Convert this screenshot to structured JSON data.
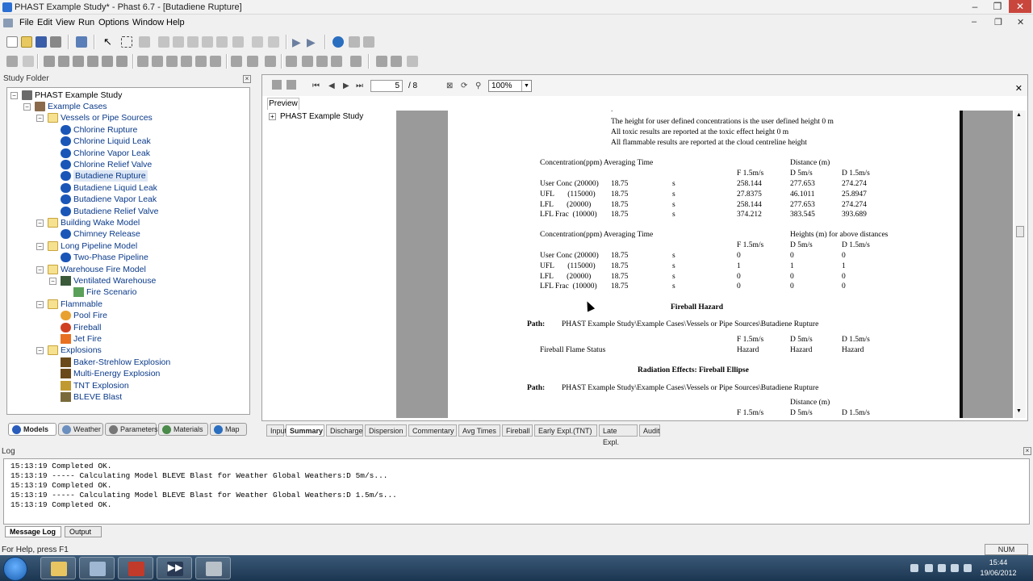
{
  "window": {
    "title": "PHAST Example Study* - Phast 6.7 - [Butadiene Rupture]"
  },
  "menu": [
    "File",
    "Edit",
    "View",
    "Run",
    "Options",
    "Window",
    "Help"
  ],
  "study_folder": {
    "title": "Study Folder",
    "root": "PHAST Example Study",
    "nodes": [
      {
        "label": "Example Cases",
        "depth": 1,
        "icon": "cases-icon",
        "expand": "-"
      },
      {
        "label": "Vessels or Pipe Sources",
        "depth": 2,
        "icon": "folder-icon",
        "expand": "-"
      },
      {
        "label": "Chlorine Rupture",
        "depth": 3,
        "icon": "model-icon",
        "expand": ""
      },
      {
        "label": "Chlorine Liquid Leak",
        "depth": 3,
        "icon": "model-icon",
        "expand": ""
      },
      {
        "label": "Chlorine Vapor Leak",
        "depth": 3,
        "icon": "model-icon",
        "expand": ""
      },
      {
        "label": "Chlorine Relief Valve",
        "depth": 3,
        "icon": "model-icon",
        "expand": ""
      },
      {
        "label": "Butadiene Rupture",
        "depth": 3,
        "icon": "model-icon",
        "expand": "",
        "selected": true
      },
      {
        "label": "Butadiene Liquid Leak",
        "depth": 3,
        "icon": "model-icon",
        "expand": ""
      },
      {
        "label": "Butadiene Vapor Leak",
        "depth": 3,
        "icon": "model-icon",
        "expand": ""
      },
      {
        "label": "Butadiene Relief Valve",
        "depth": 3,
        "icon": "model-icon",
        "expand": ""
      },
      {
        "label": "Building Wake Model",
        "depth": 2,
        "icon": "folder-icon",
        "expand": "-"
      },
      {
        "label": "Chimney Release",
        "depth": 3,
        "icon": "model-icon",
        "expand": ""
      },
      {
        "label": "Long Pipeline Model",
        "depth": 2,
        "icon": "folder-icon",
        "expand": "-"
      },
      {
        "label": "Two-Phase Pipeline",
        "depth": 3,
        "icon": "model-icon",
        "expand": ""
      },
      {
        "label": "Warehouse Fire Model",
        "depth": 2,
        "icon": "folder-icon",
        "expand": "-"
      },
      {
        "label": "Ventilated Warehouse",
        "depth": 3,
        "icon": "warehouse-icon",
        "expand": "-"
      },
      {
        "label": "Fire Scenario",
        "depth": 4,
        "icon": "fire-scenario-icon",
        "expand": ""
      },
      {
        "label": "Flammable",
        "depth": 2,
        "icon": "folder-icon",
        "expand": "-"
      },
      {
        "label": "Pool Fire",
        "depth": 3,
        "icon": "pool-fire-icon",
        "expand": ""
      },
      {
        "label": "Fireball",
        "depth": 3,
        "icon": "fireball-icon",
        "expand": ""
      },
      {
        "label": "Jet Fire",
        "depth": 3,
        "icon": "jet-fire-icon",
        "expand": ""
      },
      {
        "label": "Explosions",
        "depth": 2,
        "icon": "folder-icon",
        "expand": "-"
      },
      {
        "label": "Baker-Strehlow Explosion",
        "depth": 3,
        "icon": "explosion-icon",
        "expand": ""
      },
      {
        "label": "Multi-Energy Explosion",
        "depth": 3,
        "icon": "explosion-icon",
        "expand": ""
      },
      {
        "label": "TNT Explosion",
        "depth": 3,
        "icon": "tnt-icon",
        "expand": ""
      },
      {
        "label": "BLEVE Blast",
        "depth": 3,
        "icon": "bleve-icon",
        "expand": ""
      }
    ],
    "tabs": [
      "Models",
      "Weather",
      "Parameters",
      "Materials",
      "Map"
    ]
  },
  "preview": {
    "page": "5",
    "page_total": "/ 8",
    "zoom": "100%",
    "tab": "Preview",
    "tree_root": "PHAST Example Study",
    "report": {
      "notes": [
        "The height for user defined concentrations is the user defined height 0 m",
        "All toxic results are reported at the toxic effect height 0 m",
        "All flammable results are reported at the cloud centreline height"
      ],
      "table1": {
        "header1": "Concentration(ppm) Averaging Time",
        "header2": "Distance (m)",
        "cols": [
          "F 1.5m/s",
          "D 5m/s",
          "D 1.5m/s"
        ],
        "rows": [
          [
            "User Conc (20000)",
            "18.75",
            "s",
            "258.144",
            "277.653",
            "274.274"
          ],
          [
            "UFL       (115000)",
            "18.75",
            "s",
            "27.8375",
            "46.1011",
            "25.8947"
          ],
          [
            "LFL       (20000)",
            "18.75",
            "s",
            "258.144",
            "277.653",
            "274.274"
          ],
          [
            "LFL Frac  (10000)",
            "18.75",
            "s",
            "374.212",
            "383.545",
            "393.689"
          ]
        ]
      },
      "table2": {
        "header1": "Concentration(ppm) Averaging Time",
        "header2": "Heights (m) for above distances",
        "cols": [
          "F 1.5m/s",
          "D 5m/s",
          "D 1.5m/s"
        ],
        "rows": [
          [
            "User Conc (20000)",
            "18.75",
            "s",
            "0",
            "0",
            "0"
          ],
          [
            "UFL       (115000)",
            "18.75",
            "s",
            "1",
            "1",
            "1"
          ],
          [
            "LFL       (20000)",
            "18.75",
            "s",
            "0",
            "0",
            "0"
          ],
          [
            "LFL Frac  (10000)",
            "18.75",
            "s",
            "0",
            "0",
            "0"
          ]
        ]
      },
      "fireball_title": "Fireball Hazard",
      "path_label": "Path:",
      "path_value": "PHAST Example Study\\Example Cases\\Vessels or Pipe Sources\\Butadiene Rupture",
      "fireball_cols": [
        "F 1.5m/s",
        "D 5m/s",
        "D 1.5m/s"
      ],
      "fireball_row": [
        "Fireball Flame Status",
        "Hazard",
        "Hazard",
        "Hazard"
      ],
      "radiation_title": "Radiation Effects: Fireball Ellipse",
      "distance_header": "Distance (m)",
      "bottom_cols": [
        "F 1.5m/s",
        "D 5m/s",
        "D 1.5m/s"
      ]
    },
    "tabs": [
      "Input",
      "Summary",
      "Discharge",
      "Dispersion",
      "Commentary",
      "Avg Times",
      "Fireball",
      "Early Expl.(TNT)",
      "Late Expl.",
      "Audit"
    ],
    "active_tab": "Summary"
  },
  "log": {
    "title": "Log",
    "lines": [
      "15:13:19 Completed OK.",
      "15:13:19 ----- Calculating Model BLEVE Blast for Weather Global Weathers:D 5m/s...",
      "15:13:19 Completed OK.",
      "15:13:19 ----- Calculating Model BLEVE Blast for Weather Global Weathers:D 1.5m/s...",
      "15:13:19 Completed OK."
    ],
    "tabs": [
      "Message Log",
      "Output"
    ]
  },
  "status": {
    "help": "For Help, press F1",
    "num": "NUM"
  },
  "taskbar": {
    "time": "15:44",
    "date": "19/06/2012"
  }
}
